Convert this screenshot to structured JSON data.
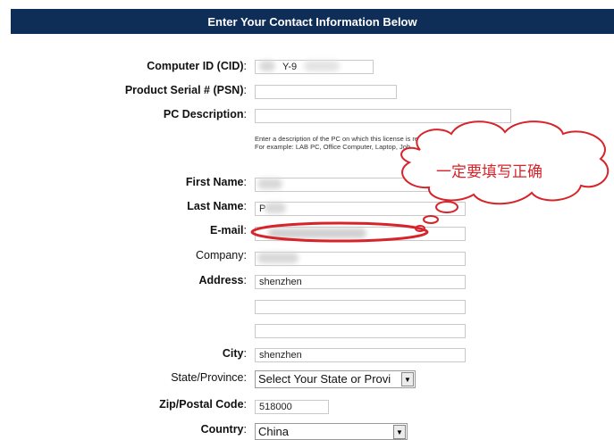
{
  "header": {
    "title": "Enter Your Contact Information Below"
  },
  "fields": {
    "cid": {
      "label": "Computer ID (CID)",
      "value": "Y-9"
    },
    "psn": {
      "label": "Product Serial # (PSN)",
      "value": ""
    },
    "pc_description": {
      "label": "PC Description",
      "value": "",
      "hint_line1": "Enter a description of the PC on which this license is registered.",
      "hint_line2": "For example: LAB PC, Office Computer, Laptop, Joh"
    },
    "first_name": {
      "label": "First Name",
      "value": ""
    },
    "last_name": {
      "label": "Last Name",
      "value": "P"
    },
    "email": {
      "label": "E-mail",
      "value": ""
    },
    "company": {
      "label": "Company",
      "value": ""
    },
    "address": {
      "label": "Address",
      "line1": "shenzhen",
      "line2": "",
      "line3": ""
    },
    "city": {
      "label": "City",
      "value": "shenzhen"
    },
    "state": {
      "label": "State/Province",
      "selected": "Select Your State or Provi"
    },
    "zip": {
      "label": "Zip/Postal Code",
      "value": "518000"
    },
    "country": {
      "label": "Country",
      "selected": "China"
    }
  },
  "annotation": {
    "text": "一定要填写正确",
    "color": "#d6242a"
  },
  "colors": {
    "header_bg": "#0f2e57",
    "annotation_red": "#d6242a"
  },
  "icons": {
    "dropdown": "chevron-down-icon"
  }
}
